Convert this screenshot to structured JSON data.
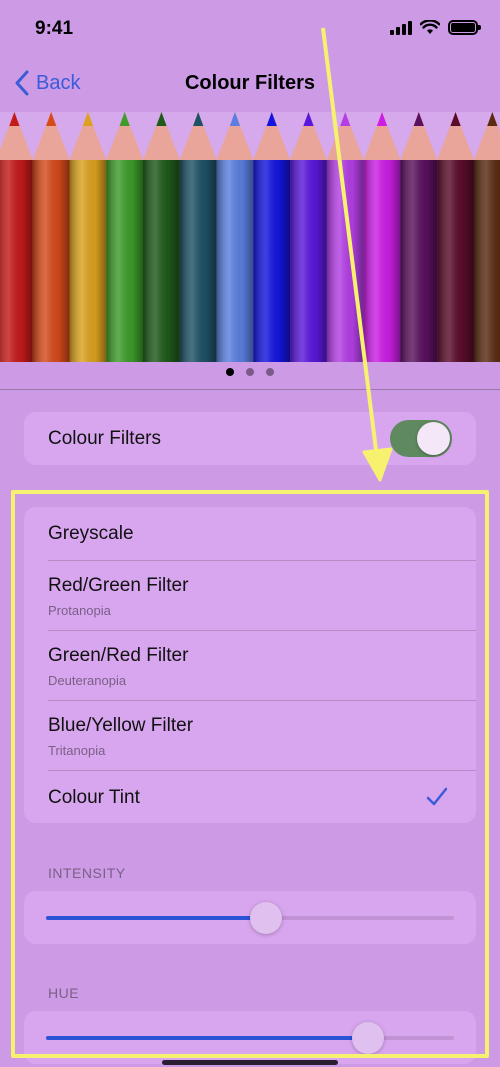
{
  "status_bar": {
    "time": "9:41"
  },
  "nav": {
    "back_label": "Back",
    "title": "Colour Filters"
  },
  "hero": {
    "page_count": 3,
    "active_page": 0
  },
  "colour_filters": {
    "label": "Colour Filters",
    "enabled": true
  },
  "filters": [
    {
      "title": "Greyscale",
      "subtitle": ""
    },
    {
      "title": "Red/Green Filter",
      "subtitle": "Protanopia"
    },
    {
      "title": "Green/Red Filter",
      "subtitle": "Deuteranopia"
    },
    {
      "title": "Blue/Yellow Filter",
      "subtitle": "Tritanopia"
    },
    {
      "title": "Colour Tint",
      "subtitle": "",
      "selected": true
    }
  ],
  "intensity": {
    "label": "INTENSITY",
    "value_fraction": 0.54
  },
  "hue": {
    "label": "HUE",
    "value_fraction": 0.79
  },
  "colors": {
    "accent": "#3b5bd8",
    "background": "#cd9be6",
    "card": "#d8a6ef",
    "toggle_on": "#5f8a5f",
    "annotation": "#f7f170"
  }
}
